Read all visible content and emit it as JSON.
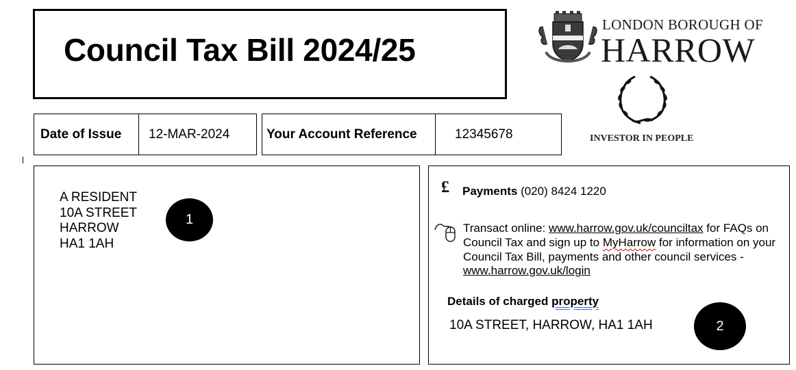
{
  "header": {
    "title": "Council Tax Bill 2024/25"
  },
  "issue": {
    "label": "Date of Issue",
    "value": "12-MAR-2024"
  },
  "account": {
    "label": "Your Account Reference",
    "value": "12345678"
  },
  "logo": {
    "line1": "LONDON BOROUGH OF",
    "line2": "HARROW",
    "investor_label": "INVESTOR IN PEOPLE"
  },
  "recipient": {
    "lines": [
      "A RESIDENT",
      "10A STREET",
      "HARROW",
      "HA1 1AH"
    ],
    "marker": "1"
  },
  "contact": {
    "payments_icon": "pound-icon",
    "payments_label": "Payments",
    "payments_phone": "(020) 8424 1220",
    "online_icon": "mouse-icon",
    "online_prefix": "Transact online: ",
    "online_link1": "www.harrow.gov.uk/counciltax",
    "online_mid1": " for FAQs on Council Tax and sign up to ",
    "online_brand": "MyHarrow",
    "online_mid2": " for information on your Council Tax Bill, payments and other council services - ",
    "online_link2": "www.harrow.gov.uk/login"
  },
  "property": {
    "title_prefix": "Details of charged ",
    "title_word": "property",
    "address": "10A STREET, HARROW, HA1 1AH",
    "marker": "2"
  }
}
